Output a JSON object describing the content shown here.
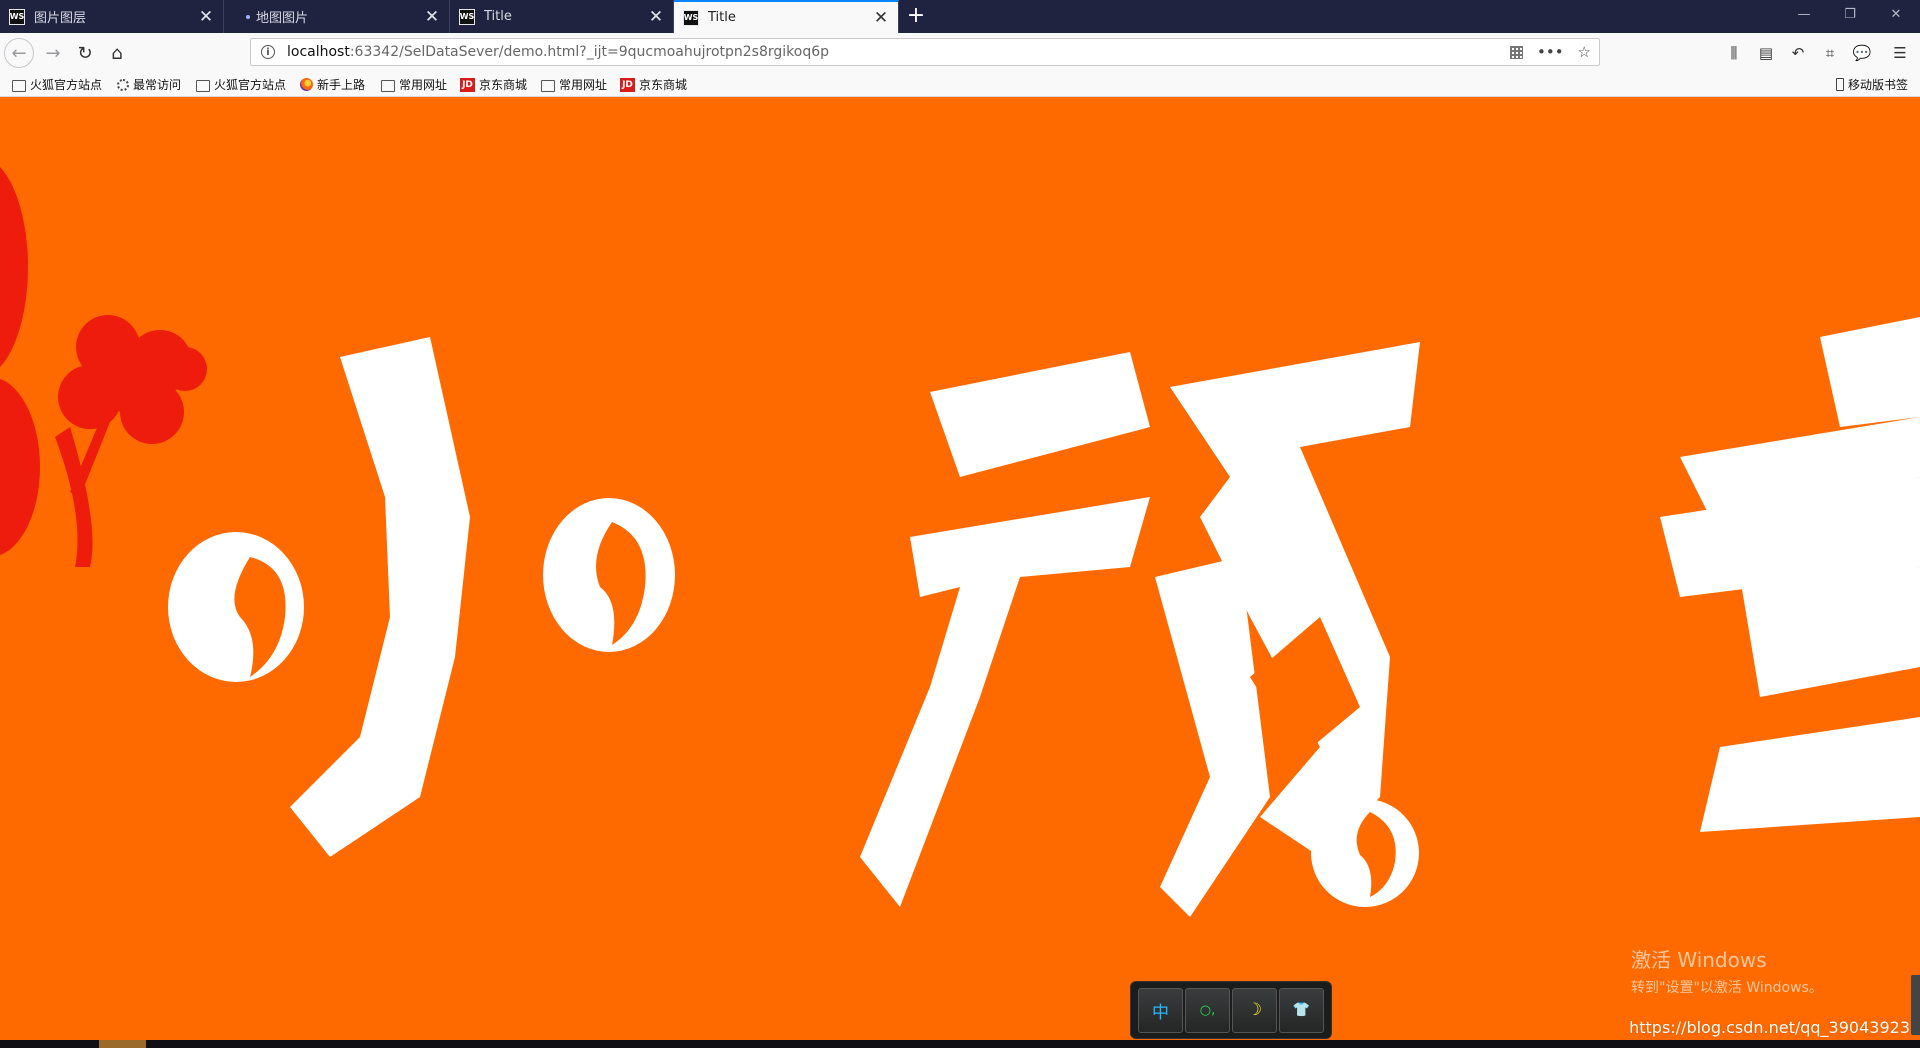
{
  "tabs": [
    {
      "label": "图片图层",
      "favicon": "WS",
      "active": false
    },
    {
      "label": "地图图片",
      "favicon": "dot",
      "active": false
    },
    {
      "label": "Title",
      "favicon": "WS",
      "active": false
    },
    {
      "label": "Title",
      "favicon": "WS",
      "active": true
    }
  ],
  "window_controls": {
    "minimize": "—",
    "restore": "❐",
    "close": "✕"
  },
  "nav": {
    "url_host": "localhost",
    "url_rest": ":63342/SelDataSever/demo.html?_ijt=9qucmoahujrotpn2s8rgikoq6p"
  },
  "bookmarks": [
    {
      "label": "火狐官方站点",
      "icon": "folder-icon"
    },
    {
      "label": "最常访问",
      "icon": "gear-icon"
    },
    {
      "label": "火狐官方站点",
      "icon": "folder-icon"
    },
    {
      "label": "新手上路",
      "icon": "firefox-icon"
    },
    {
      "label": "常用网址",
      "icon": "folder-icon"
    },
    {
      "label": "京东商城",
      "icon": "jd-icon"
    },
    {
      "label": "常用网址",
      "icon": "folder-icon"
    },
    {
      "label": "京东商城",
      "icon": "jd-icon"
    }
  ],
  "mobile_bookmarks": "移动版书签",
  "content": {
    "background_color": "#ff6a00",
    "activate_windows_title": "激活 Windows",
    "activate_windows_hint": "转到\"设置\"以激活 Windows。",
    "watermark": "https://blog.csdn.net/qq_39043923"
  },
  "ime_bar": {
    "keys": [
      "中",
      "○,",
      "☽",
      "👕"
    ]
  }
}
